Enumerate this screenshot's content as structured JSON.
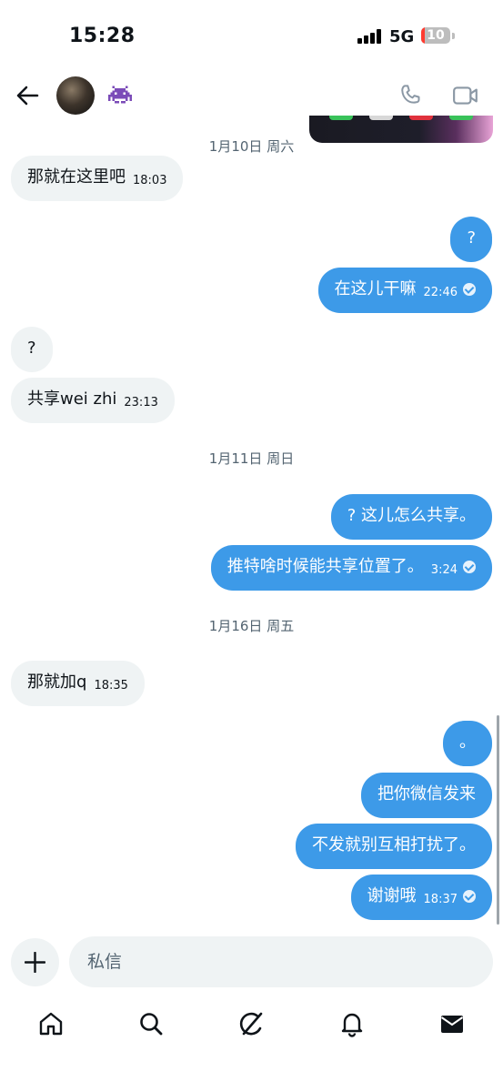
{
  "status_bar": {
    "time": "15:28",
    "network": "5G",
    "battery": "10"
  },
  "header": {
    "avatar_icon": "avatar",
    "emoji_icon": "alien-monster-icon",
    "actions": [
      "phone-icon",
      "video-icon"
    ]
  },
  "composer": {
    "placeholder": "私信"
  },
  "dates": [
    "1月10日 周六",
    "1月11日 周日",
    "1月16日 周五"
  ],
  "messages": [
    {
      "side": "in",
      "text": "那就在这里吧",
      "time": "18:03"
    },
    {
      "side": "out",
      "text": "?"
    },
    {
      "side": "out",
      "text": "在这儿干嘛",
      "time": "22:46",
      "read": true
    },
    {
      "side": "in",
      "text": "?"
    },
    {
      "side": "in",
      "text": "共享wei zhi",
      "time": "23:13"
    },
    {
      "side": "out",
      "text": "? 这儿怎么共享。"
    },
    {
      "side": "out",
      "text": "推特啥时候能共享位置了。",
      "time": "3:24",
      "read": true
    },
    {
      "side": "in",
      "text": "那就加q",
      "time": "18:35"
    },
    {
      "side": "out",
      "text": "。"
    },
    {
      "side": "out",
      "text": "把你微信发来"
    },
    {
      "side": "out",
      "text": "不发就别互相打扰了。"
    },
    {
      "side": "out",
      "text": "谢谢哦",
      "time": "18:37",
      "read": true
    }
  ],
  "nav": [
    "home-icon",
    "search-icon",
    "grok-icon",
    "notifications-icon",
    "messages-icon"
  ],
  "colors": {
    "outgoing": "#3d9ae8",
    "incoming": "#eff3f4",
    "text": "#0f1419",
    "muted": "#536471"
  }
}
